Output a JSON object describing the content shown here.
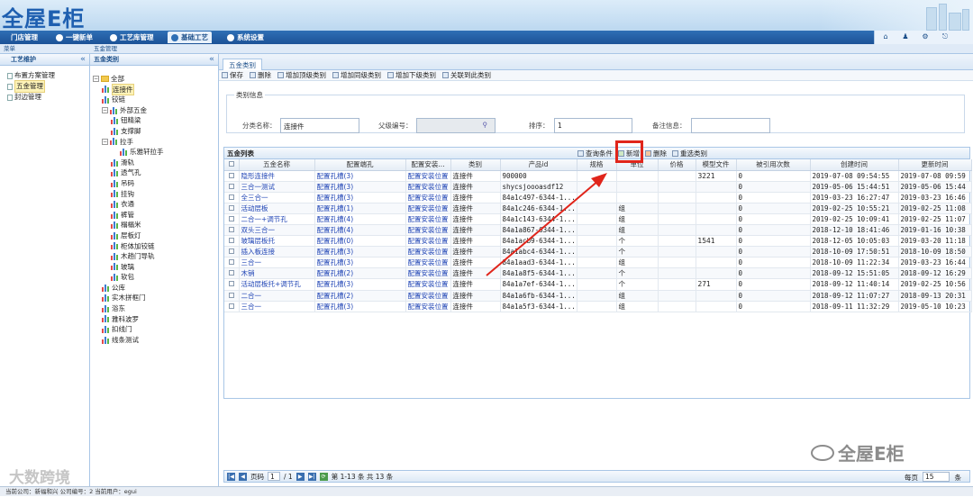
{
  "app": {
    "logo": "全屋E柜"
  },
  "menu": [
    {
      "label": "门店管理"
    },
    {
      "label": "一键新单"
    },
    {
      "label": "工艺库管理"
    },
    {
      "label": "基础工艺"
    },
    {
      "label": "系统设置"
    }
  ],
  "subbar": {
    "left": "菜单",
    "right": "五金管理"
  },
  "left_panel": {
    "section": "工艺维护",
    "items": [
      "布置方案管理",
      "五金管理",
      "封边管理"
    ]
  },
  "mid_panel": {
    "title": "五金类别"
  },
  "tree": [
    {
      "label": "全部",
      "level": 0,
      "type": "folder",
      "toggle": "⊟"
    },
    {
      "label": "连接件",
      "level": 1,
      "type": "chart",
      "highlight": true
    },
    {
      "label": "铰链",
      "level": 1,
      "type": "chart"
    },
    {
      "label": "外部五金",
      "level": 1,
      "type": "chart",
      "toggle": "⊟"
    },
    {
      "label": "钮精梁",
      "level": 2,
      "type": "chart"
    },
    {
      "label": "支撑脚",
      "level": 2,
      "type": "chart"
    },
    {
      "label": "拉手",
      "level": 1,
      "type": "chart",
      "toggle": "⊟"
    },
    {
      "label": "乐雅轩拉手",
      "level": 3,
      "type": "chart"
    },
    {
      "label": "滑轨",
      "level": 2,
      "type": "chart"
    },
    {
      "label": "透气孔",
      "level": 2,
      "type": "chart"
    },
    {
      "label": "吊码",
      "level": 2,
      "type": "chart"
    },
    {
      "label": "挂钩",
      "level": 2,
      "type": "chart"
    },
    {
      "label": "衣通",
      "level": 2,
      "type": "chart"
    },
    {
      "label": "裤管",
      "level": 2,
      "type": "chart"
    },
    {
      "label": "榻榻米",
      "level": 2,
      "type": "chart"
    },
    {
      "label": "层板灯",
      "level": 2,
      "type": "chart"
    },
    {
      "label": "柜体加铰链",
      "level": 2,
      "type": "chart"
    },
    {
      "label": "木趟门导轨",
      "level": 2,
      "type": "chart"
    },
    {
      "label": "玻璃",
      "level": 2,
      "type": "chart"
    },
    {
      "label": "软包",
      "level": 2,
      "type": "chart"
    },
    {
      "label": "公库",
      "level": 1,
      "type": "chart"
    },
    {
      "label": "实木拼框门",
      "level": 1,
      "type": "chart"
    },
    {
      "label": "浴东",
      "level": 1,
      "type": "chart"
    },
    {
      "label": "雅科波罗",
      "level": 1,
      "type": "chart"
    },
    {
      "label": "扣线门",
      "level": 1,
      "type": "chart"
    },
    {
      "label": "线条测试",
      "level": 1,
      "type": "chart"
    }
  ],
  "main": {
    "tab": "五金类别",
    "toolbar": [
      "保存",
      "删除",
      "增加顶级类别",
      "增加同级类别",
      "增加下级类别",
      "关联到此类别"
    ],
    "form": {
      "legend": "类别信息",
      "name_label": "分类名称：",
      "name_value": "连接件",
      "parent_label": "父级编号：",
      "sort_label": "排序：",
      "sort_value": "1",
      "remark_label": "备注信息："
    },
    "grid": {
      "title": "五金列表",
      "tools": [
        "查询条件",
        "新增",
        "删除",
        "重选类别"
      ],
      "columns": [
        "",
        "五金名称",
        "配置端孔",
        "配置安装...",
        "类别",
        "产品id",
        "规格",
        "单位",
        "价格",
        "模型文件",
        "被引用次数",
        "创建时间",
        "更新时间"
      ],
      "rows": [
        [
          "隐形连接件",
          "配置孔槽(3)",
          "配置安装位置",
          "连接件",
          "900000",
          "",
          "",
          "",
          "3221",
          "0",
          "2019-07-08 09:54:55",
          "2019-07-08 09:59"
        ],
        [
          "三合一测试",
          "配置孔槽(3)",
          "配置安装位置",
          "连接件",
          "shycsjoooasdf12",
          "",
          "",
          "",
          "",
          "0",
          "2019-05-06 15:44:51",
          "2019-05-06 15:44"
        ],
        [
          "全三合一",
          "配置孔槽(3)",
          "配置安装位置",
          "连接件",
          "84a1c497-6344-1...",
          "",
          "",
          "",
          "",
          "0",
          "2019-03-23 16:27:47",
          "2019-03-23 16:46"
        ],
        [
          "活动层板",
          "配置孔槽(1)",
          "配置安装位置",
          "连接件",
          "84a1c246-6344-1...",
          "",
          "组",
          "",
          "",
          "0",
          "2019-02-25 10:55:21",
          "2019-02-25 11:08"
        ],
        [
          "二合一+调节孔",
          "配置孔槽(4)",
          "配置安装位置",
          "连接件",
          "84a1c143-6344-1...",
          "",
          "组",
          "",
          "",
          "0",
          "2019-02-25 10:09:41",
          "2019-02-25 11:07"
        ],
        [
          "双头三合一",
          "配置孔槽(4)",
          "配置安装位置",
          "连接件",
          "84a1a867-6344-1...",
          "",
          "组",
          "",
          "",
          "0",
          "2018-12-10 18:41:46",
          "2019-01-16 10:38"
        ],
        [
          "玻璃层板托",
          "配置孔槽(0)",
          "配置安装位置",
          "连接件",
          "84a1acb9-6344-1...",
          "",
          "个",
          "",
          "1541",
          "0",
          "2018-12-05 10:05:03",
          "2019-03-20 11:18"
        ],
        [
          "插入板连接",
          "配置孔槽(3)",
          "配置安装位置",
          "连接件",
          "84a1abc4-6344-1...",
          "",
          "个",
          "",
          "",
          "0",
          "2018-10-09 17:50:51",
          "2018-10-09 18:50"
        ],
        [
          "三合一",
          "配置孔槽(3)",
          "配置安装位置",
          "连接件",
          "84a1aad3-6344-1...",
          "",
          "组",
          "",
          "",
          "0",
          "2018-10-09 11:22:34",
          "2019-03-23 16:44"
        ],
        [
          "木销",
          "配置孔槽(2)",
          "配置安装位置",
          "连接件",
          "84a1a8f5-6344-1...",
          "",
          "个",
          "",
          "",
          "0",
          "2018-09-12 15:51:05",
          "2018-09-12 16:29"
        ],
        [
          "活动层板托+调节孔",
          "配置孔槽(3)",
          "配置安装位置",
          "连接件",
          "84a1a7ef-6344-1...",
          "",
          "个",
          "",
          "271",
          "0",
          "2018-09-12 11:40:14",
          "2019-02-25 10:56"
        ],
        [
          "二合一",
          "配置孔槽(2)",
          "配置安装位置",
          "连接件",
          "84a1a6fb-6344-1...",
          "",
          "组",
          "",
          "",
          "0",
          "2018-09-12 11:07:27",
          "2018-09-13 20:31"
        ],
        [
          "三合一",
          "配置孔槽(3)",
          "配置安装位置",
          "连接件",
          "84a1a5f3-6344-1...",
          "",
          "组",
          "",
          "",
          "0",
          "2018-09-11 11:32:29",
          "2019-05-10 10:23"
        ]
      ]
    },
    "pager": {
      "page_label": "页码",
      "page": "1",
      "total_pages": "/ 1",
      "info": "第 1-13 条  共 13 条",
      "per_page_label": "每页",
      "per_page": "15",
      "unit": "条"
    }
  },
  "status": "当前公司：新福和兴   公司编号：2    当前用户：egui",
  "watermarks": {
    "left": "大数跨境",
    "right": "全屋E柜"
  },
  "colors": {
    "accent": "#1c5297",
    "highlight_box": "#e0251b",
    "arrow": "#e0251b"
  }
}
